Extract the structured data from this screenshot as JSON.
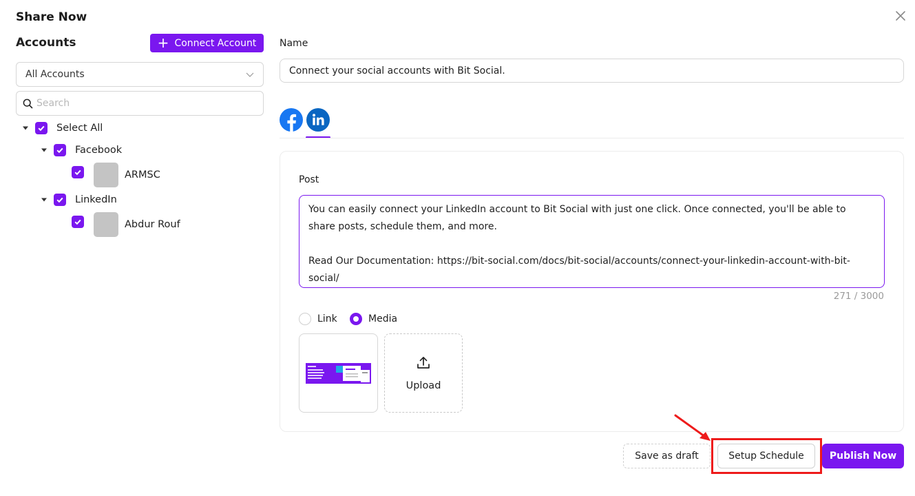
{
  "modal": {
    "title": "Share Now"
  },
  "accounts": {
    "heading": "Accounts",
    "connect_label": "Connect Account",
    "filter_value": "All Accounts",
    "search_placeholder": "Search",
    "tree": {
      "select_all": "Select All",
      "groups": [
        {
          "label": "Facebook",
          "items": [
            {
              "label": "ARMSC"
            }
          ]
        },
        {
          "label": "LinkedIn",
          "items": [
            {
              "label": "Abdur Rouf"
            }
          ]
        }
      ]
    }
  },
  "form": {
    "name_label": "Name",
    "name_value": "Connect your social accounts with Bit Social.",
    "platform_tabs": [
      {
        "icon": "facebook-icon",
        "active": false
      },
      {
        "icon": "linkedin-icon",
        "active": true
      }
    ],
    "post_label": "Post",
    "post_text": "You can easily connect your LinkedIn account to Bit Social with just one click. Once connected, you'll be able to share posts, schedule them, and more.\n\nRead Our Documentation: https://bit-social.com/docs/bit-social/accounts/connect-your-linkedin-account-with-bit-social/",
    "char_count": "271 / 3000",
    "attach_options": [
      {
        "label": "Link",
        "selected": false
      },
      {
        "label": "Media",
        "selected": true
      }
    ],
    "upload_label": "Upload"
  },
  "actions": {
    "draft_label": "Save as draft",
    "schedule_label": "Setup Schedule",
    "publish_label": "Publish Now"
  },
  "colors": {
    "accent": "#7a17ef",
    "highlight": "#ee1b1b",
    "facebook": "#1877f2",
    "linkedin": "#0a66c2"
  }
}
